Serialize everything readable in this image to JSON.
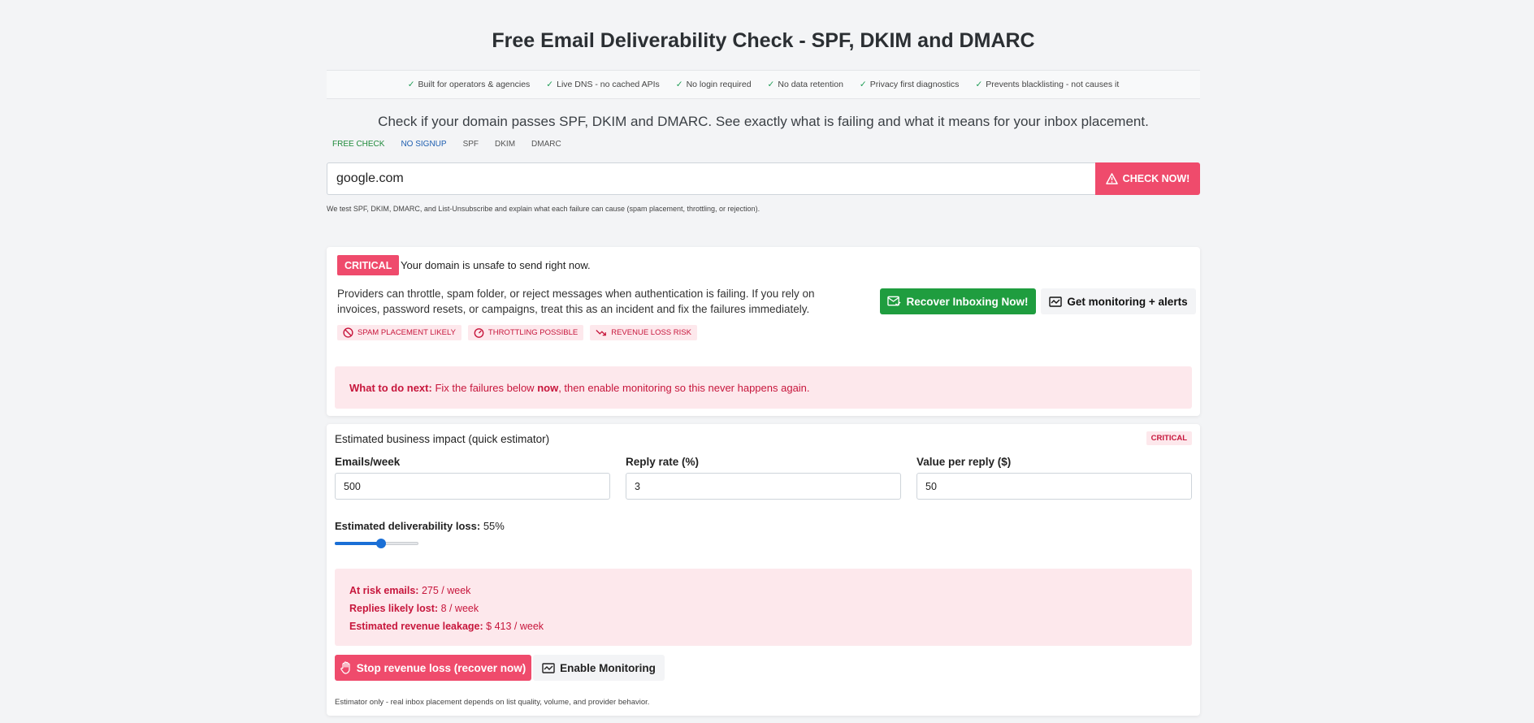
{
  "page": {
    "title": "Free Email Deliverability Check - SPF, DKIM and DMARC",
    "lead": "Check if your domain passes SPF, DKIM and DMARC. See exactly what is failing and what it means for your inbox placement."
  },
  "trust": [
    "Built for operators & agencies",
    "Live DNS - no cached APIs",
    "No login required",
    "No data retention",
    "Privacy first diagnostics",
    "Prevents blacklisting - not causes it"
  ],
  "tags": [
    "FREE CHECK",
    "NO SIGNUP",
    "SPF",
    "DKIM",
    "DMARC"
  ],
  "search": {
    "value": "google.com",
    "button_label": "CHECK NOW!",
    "note": "We test SPF, DKIM, DMARC, and List-Unsubscribe and explain what each failure can cause (spam placement, throttling, or rejection)."
  },
  "status": {
    "badge": "CRITICAL",
    "headline": "Your domain is unsafe to send right now.",
    "description": "Providers can throttle, spam folder, or reject messages when authentication is failing. If you rely on invoices, password resets, or campaigns, treat this as an incident and fix the failures immediately.",
    "risks": [
      "SPAM PLACEMENT LIKELY",
      "THROTTLING POSSIBLE",
      "REVENUE LOSS RISK"
    ],
    "recover_label": "Recover Inboxing Now!",
    "monitor_label": "Get monitoring + alerts",
    "next_label": "What to do next:",
    "next_text_before": "Fix the failures below",
    "next_text_bold": "now",
    "next_text_after": ", then enable monitoring so this never happens again."
  },
  "estimator": {
    "title": "Estimated business impact (quick estimator)",
    "badge": "CRITICAL",
    "fields": [
      {
        "label": "Emails/week",
        "value": "500"
      },
      {
        "label": "Reply rate (%)",
        "value": "3"
      },
      {
        "label": "Value per reply ($)",
        "value": "50"
      }
    ],
    "loss_label": "Estimated deliverability loss:",
    "loss_value": "55%",
    "loss_fraction": 0.55,
    "results": [
      {
        "label": "At risk emails:",
        "value": "275 / week"
      },
      {
        "label": "Replies likely lost:",
        "value": "8 / week"
      },
      {
        "label": "Estimated revenue leakage:",
        "value": "$ 413 / week"
      }
    ],
    "stop_label": "Stop revenue loss (recover now)",
    "monitor_label": "Enable Monitoring",
    "disclaimer": "Estimator only - real inbox placement depends on list quality, volume, and provider behavior."
  },
  "colors": {
    "critical": "#ef4b6c",
    "success": "#1f9d3f",
    "alert_bg": "#fde8ec",
    "alert_text": "#c7163c",
    "slider": "#1a6fd6"
  }
}
